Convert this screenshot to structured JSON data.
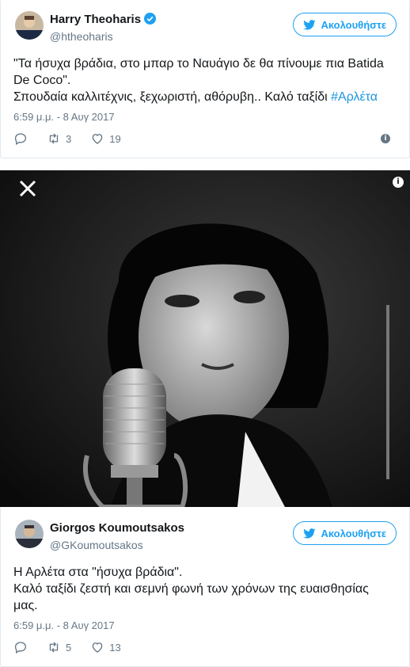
{
  "tweets": [
    {
      "author": "Harry Theoharis",
      "handle": "@htheoharis",
      "verified": true,
      "follow_label": "Ακολουθήστε",
      "text_line1": "\"Τα ήσυχα βράδια, στο μπαρ το Ναυάγιο δε θα πίνουμε πια Batida De Coco\".",
      "text_line2": "Σπουδαία καλλιτέχνις, ξεχωριστή, αθόρυβη.. Καλό ταξίδι ",
      "hashtag": "#Αρλέτα",
      "timestamp": "6:59 μ.μ. - 8 Αυγ 2017",
      "retweets": "3",
      "likes": "19"
    },
    {
      "author": "Giorgos Koumoutsakos",
      "handle": "@GKoumoutsakos",
      "follow_label": "Ακολουθήστε",
      "text_line1": "Η Αρλέτα στα \"ήσυχα βράδια\".",
      "text_line2": "Καλό ταξίδι ζεστή και σεμνή φωνή των χρόνων της ευαισθησίας μας.",
      "timestamp": "6:59 μ.μ. - 8 Αυγ 2017",
      "retweets": "5",
      "likes": "13"
    }
  ],
  "colors": {
    "brand": "#1da1f2",
    "link": "#1b95e0",
    "muted": "#657786",
    "border": "#e1e8ed"
  },
  "icons": [
    "twitter-bird-icon",
    "verified-badge-icon",
    "reply-icon",
    "retweet-icon",
    "like-heart-icon",
    "info-icon",
    "close-icon"
  ]
}
